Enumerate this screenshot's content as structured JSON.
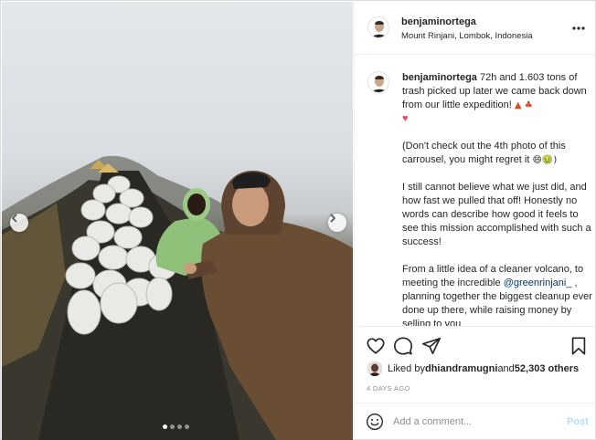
{
  "post": {
    "username": "benjaminortega",
    "location": "Mount Rinjani, Lombok, Indonesia",
    "more_icon": "more-horizontal-icon"
  },
  "caption": {
    "username": "benjaminortega",
    "line1": " 72h and 1.603 tons of trash picked up later we came back down from our little expedition! ",
    "line1_emoji": "▲ ♣",
    "heart": "♥",
    "para2": "(Don't check out the 4th photo of this carrousel, you might regret it ",
    "para2_emoji": "😄🤢)",
    "para3": "I still cannot believe what we just did, and how fast we pulled that off! Honestly no words can describe how good it feels to see this mission accomplished with such a success!",
    "para4_a": "From a little idea of a cleaner volcano, to meeting the incredible ",
    "mention": "@greenrinjani_",
    "para4_b": " , planning together the biggest cleanup ever done up there, while raising money by selling to you"
  },
  "likes": {
    "prefix": "Liked by ",
    "user": "dhiandramugni",
    "middle": " and ",
    "count": "52,303 others"
  },
  "time_ago": "4 DAYS AGO",
  "comment": {
    "placeholder": "Add a comment...",
    "post_label": "Post"
  },
  "carousel": {
    "total": 4,
    "active_index": 0
  },
  "colors": {
    "link": "#00376b",
    "post_disabled": "#b2dffc",
    "heart": "#ed4956"
  }
}
